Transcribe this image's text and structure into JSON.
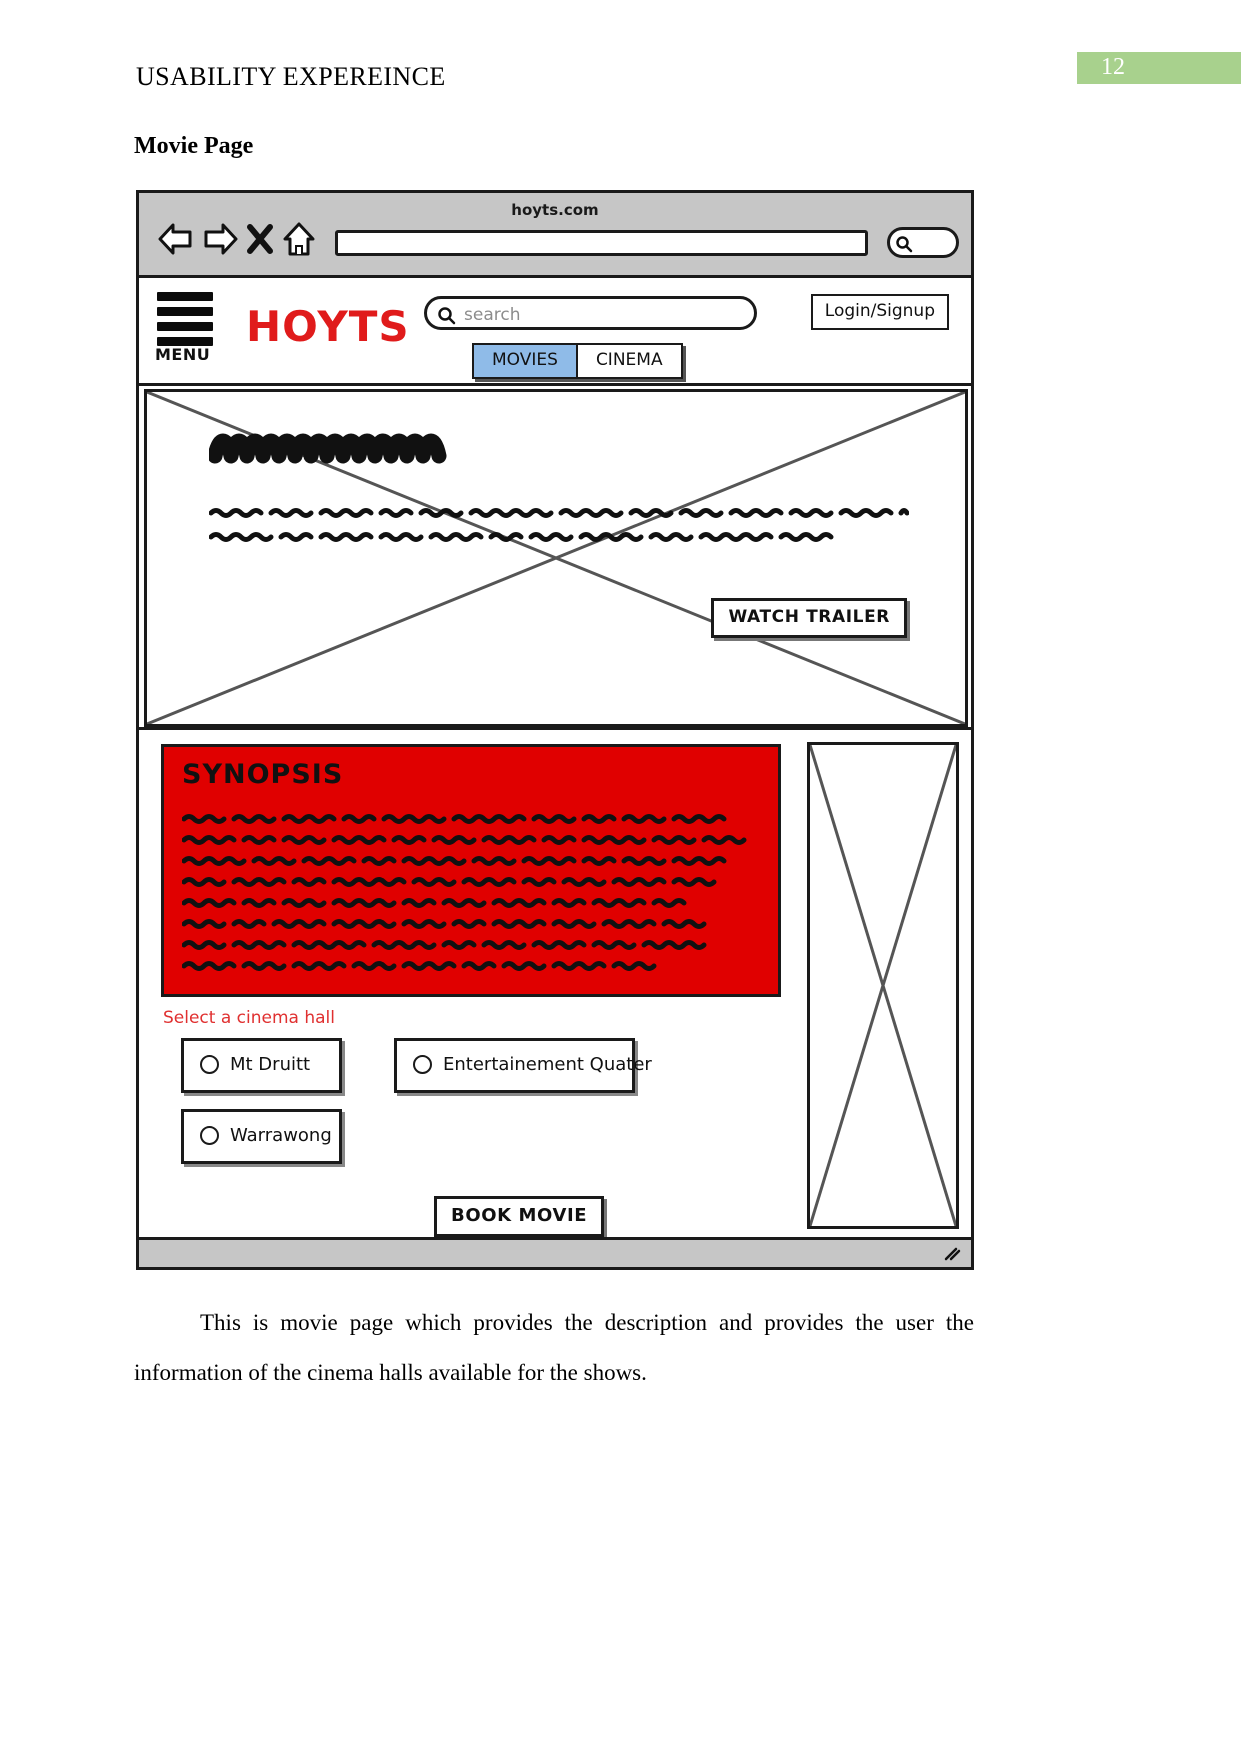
{
  "document": {
    "running_head": "USABILITY EXPEREINCE",
    "page_number": "12",
    "section_title": "Movie Page",
    "caption": "This is movie page which provides the description and provides the user the information of the cinema halls available for the shows."
  },
  "browser": {
    "title": "hoyts.com",
    "url_value": "",
    "back_icon": "back-arrow-icon",
    "forward_icon": "forward-arrow-icon",
    "stop_icon": "close-x-icon",
    "home_icon": "home-icon",
    "search_icon": "magnifier-icon"
  },
  "navbar": {
    "menu_label": "MENU",
    "brand": "HOYTS",
    "search_placeholder": "search",
    "search_value": "",
    "login_label": "Login/Signup",
    "tabs": [
      {
        "label": "MOVIES",
        "active": true
      },
      {
        "label": "CINEMA",
        "active": false
      }
    ]
  },
  "hero": {
    "placeholder_type": "image-placeholder-cross",
    "title_scribble": "movie-title-placeholder",
    "description_scribble": "movie-description-placeholder",
    "watch_trailer_label": "WATCH TRAILER"
  },
  "synopsis": {
    "heading": "SYNOPSIS",
    "body_scribble": "synopsis-body-placeholder",
    "background_color": "#e00000"
  },
  "cinema_selection": {
    "prompt": "Select a cinema hall",
    "prompt_color": "#e03030",
    "options": [
      {
        "label": "Mt Druitt",
        "selected": false
      },
      {
        "label": "Entertainement Quater",
        "selected": false
      },
      {
        "label": "Warrawong",
        "selected": false
      }
    ],
    "book_label": "BOOK MOVIE"
  },
  "side_panel": {
    "placeholder_type": "image-placeholder-cross"
  },
  "colors": {
    "brand_red": "#e01b1b",
    "synopsis_red": "#e00000",
    "tab_active_blue": "#8fbbe8",
    "page_badge_green": "#a8d18d",
    "chrome_gray": "#c6c6c6"
  }
}
